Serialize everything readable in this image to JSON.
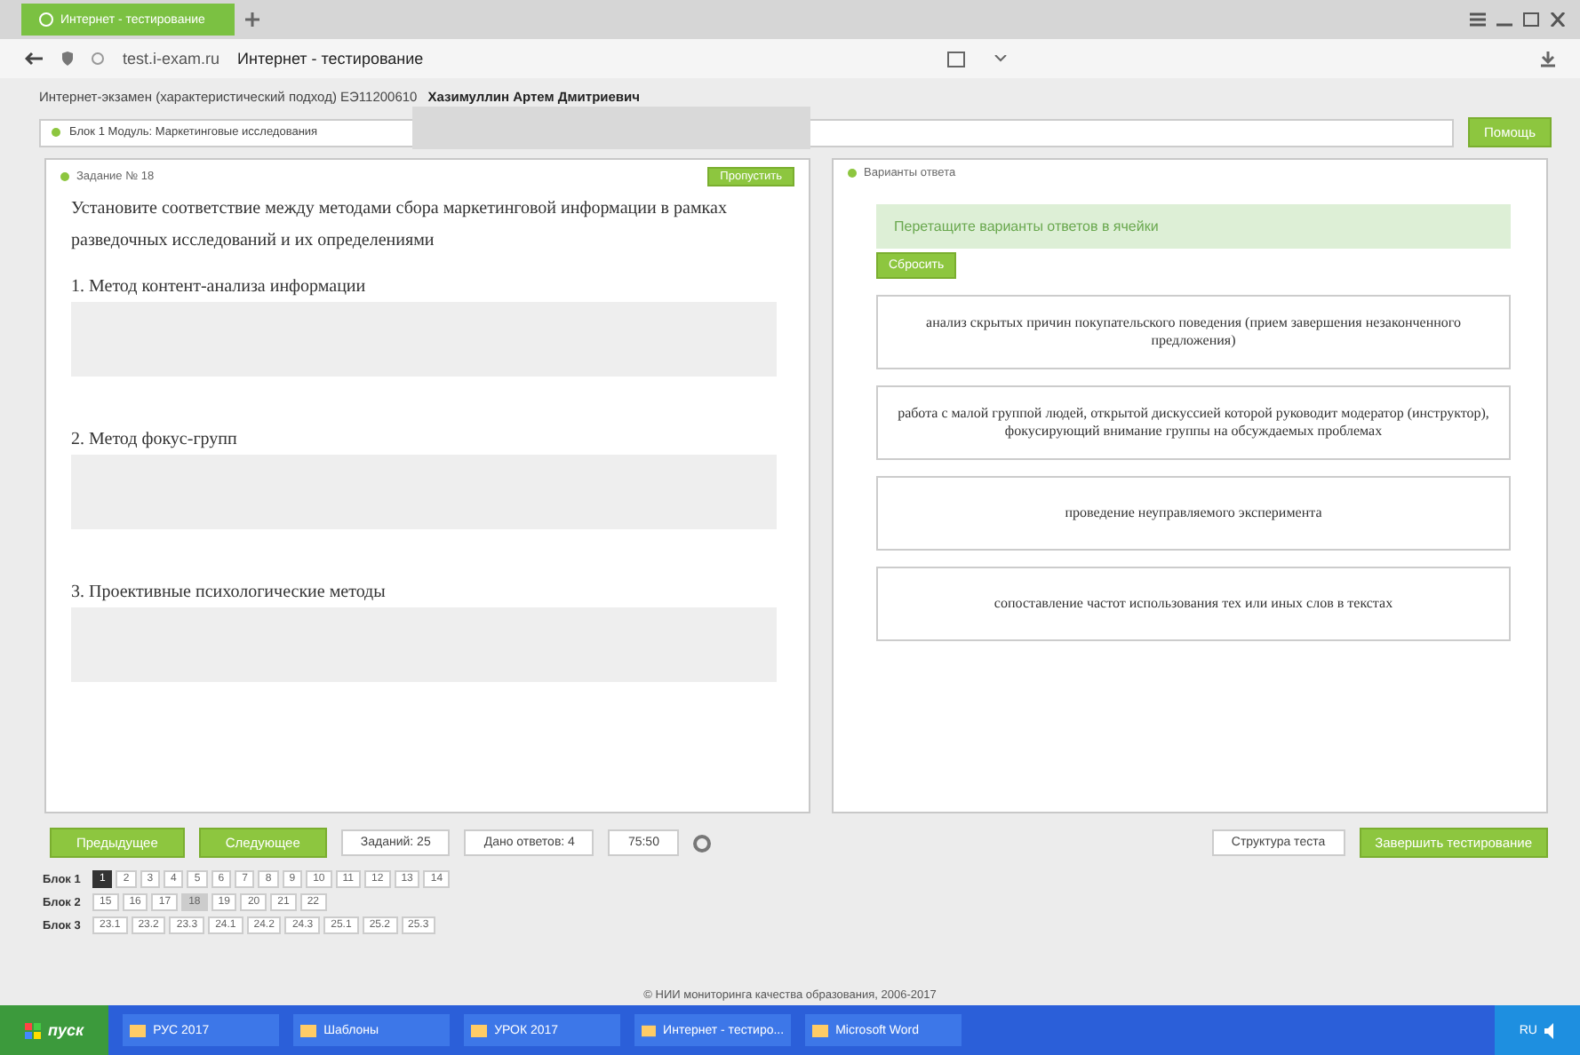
{
  "browser": {
    "tab_title": "Интернет - тестирование",
    "url_host": "test.i-exam.ru",
    "url_title": "Интернет - тестирование"
  },
  "header": {
    "exam": "Интернет-экзамен (характеристический подход) ЕЭ11200610",
    "student": "Хазимуллин Артем Дмитриевич"
  },
  "breadcrumb": "Блок 1 Модуль: Маркетинговые исследования",
  "help_button": "Помощь",
  "task": {
    "title": "Задание № 18",
    "action_button": "Пропустить",
    "question": "Установите соответствие между методами сбора маркетинговой информации в рамках разведочных исследований и их определениями",
    "items": [
      {
        "label": "1. Метод контент-анализа информации"
      },
      {
        "label": "2. Метод фокус-групп"
      },
      {
        "label": "3. Проективные психологические методы"
      }
    ]
  },
  "answers": {
    "title": "Варианты ответа",
    "hint": "Перетащите варианты ответов в ячейки",
    "reset_button": "Сбросить",
    "options": [
      "анализ скрытых причин покупательского поведения (прием завершения незаконченного предложения)",
      "работа с малой группой людей, открытой дискуссией которой руководит модератор (инструктор), фокусирующий внимание группы на обсуждаемых проблемах",
      "проведение неуправляемого эксперимента",
      "сопоставление частот использования тех или иных слов в текстах"
    ]
  },
  "nav": {
    "prev": "Предыдущее",
    "next": "Следующее",
    "tasks_count": "Заданий: 25",
    "answered_count": "Дано ответов: 4",
    "timer": "75:50",
    "structure": "Структура теста",
    "finish": "Завершить тестирование"
  },
  "blocks": [
    {
      "label": "Блок 1",
      "tasks": [
        {
          "n": "1",
          "selected": true
        },
        {
          "n": "2",
          "selected": false
        },
        {
          "n": "3",
          "selected": false
        },
        {
          "n": "4",
          "selected": false
        },
        {
          "n": "5",
          "selected": false
        },
        {
          "n": "6",
          "selected": false
        },
        {
          "n": "7",
          "selected": false
        },
        {
          "n": "8",
          "selected": false
        },
        {
          "n": "9",
          "selected": false
        },
        {
          "n": "10",
          "selected": false
        },
        {
          "n": "11",
          "selected": false
        },
        {
          "n": "12",
          "selected": false
        },
        {
          "n": "13",
          "selected": false
        },
        {
          "n": "14",
          "selected": false
        }
      ]
    },
    {
      "label": "Блок 2",
      "tasks": [
        {
          "n": "15",
          "selected": false
        },
        {
          "n": "16",
          "selected": false
        },
        {
          "n": "17",
          "selected": false
        },
        {
          "n": "18",
          "selected": false,
          "current": true
        },
        {
          "n": "19",
          "selected": false
        },
        {
          "n": "20",
          "selected": false
        },
        {
          "n": "21",
          "selected": false
        },
        {
          "n": "22",
          "selected": false
        }
      ]
    },
    {
      "label": "Блок 3",
      "tasks": [
        {
          "n": "23.1",
          "selected": false
        },
        {
          "n": "23.2",
          "selected": false
        },
        {
          "n": "23.3",
          "selected": false
        },
        {
          "n": "24.1",
          "selected": false
        },
        {
          "n": "24.2",
          "selected": false
        },
        {
          "n": "24.3",
          "selected": false
        },
        {
          "n": "25.1",
          "selected": false
        },
        {
          "n": "25.2",
          "selected": false
        },
        {
          "n": "25.3",
          "selected": false
        }
      ]
    }
  ],
  "footer": "© НИИ мониторинга качества образования, 2006-2017",
  "taskbar": {
    "start": "пуск",
    "items": [
      "РУС 2017",
      "Шаблоны",
      "УРОК 2017",
      "Интернет - тестиро...",
      "Microsoft Word"
    ],
    "tray": "RU"
  }
}
